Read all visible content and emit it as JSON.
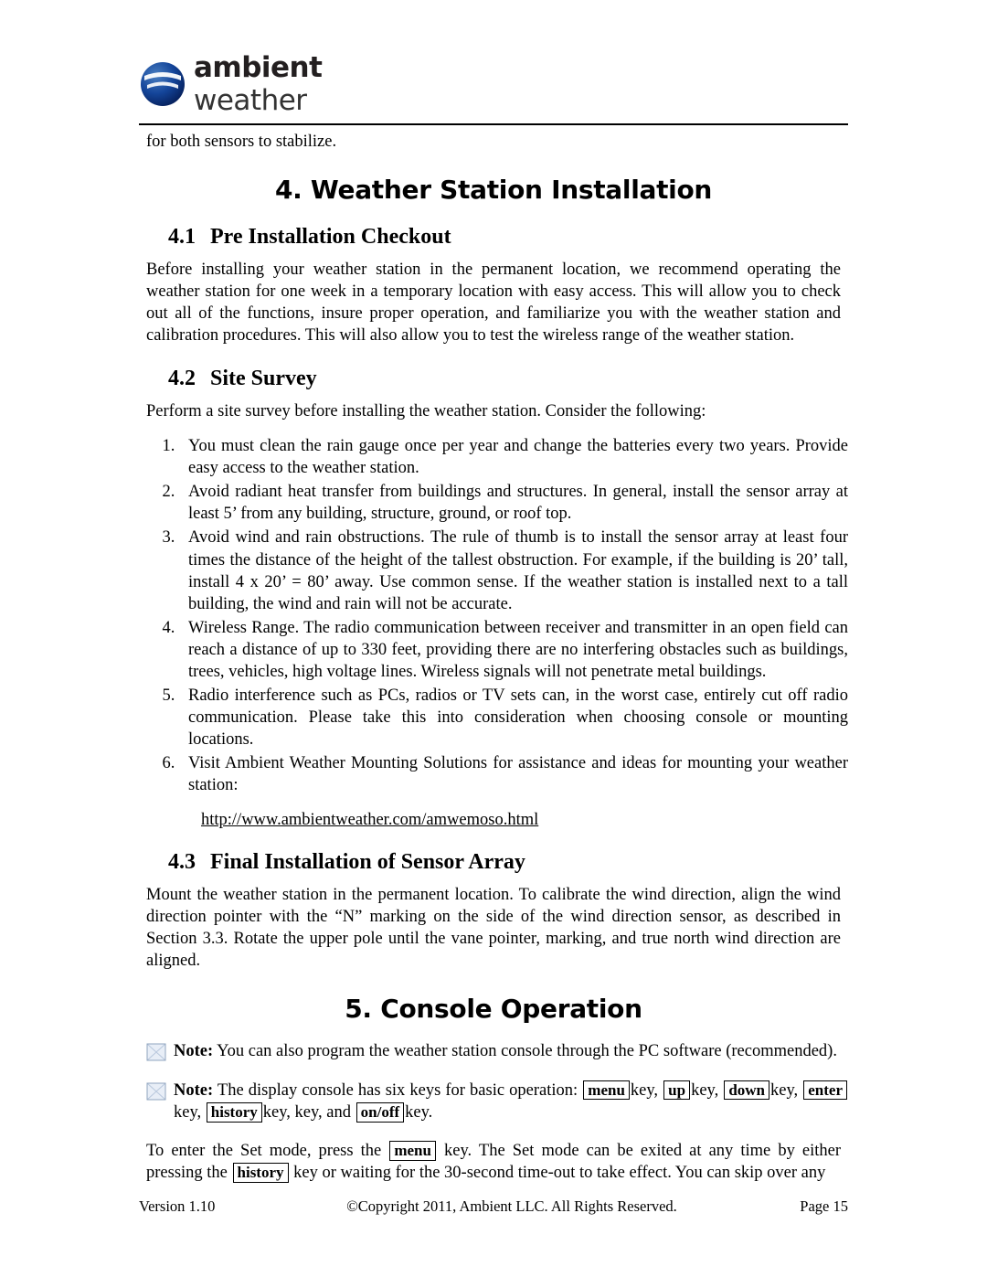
{
  "header": {
    "logo_bold": "ambient",
    "logo_light": "weather"
  },
  "top_fragment": "for both sensors to stabilize.",
  "chapter4": {
    "title": "4. Weather Station Installation",
    "sections": [
      {
        "num": "4.1",
        "title": "Pre Installation Checkout",
        "body": "Before installing your weather station in the permanent location, we recommend operating the weather station for one week in a temporary location with easy access. This will allow you to check out all of the functions, insure proper operation, and familiarize you with the weather station and calibration procedures. This will also allow you to test the wireless range of the weather station."
      },
      {
        "num": "4.2",
        "title": "Site Survey",
        "body": "Perform a site survey before installing the weather station. Consider the following:"
      },
      {
        "num": "4.3",
        "title": "Final Installation of Sensor Array",
        "body": "Mount the weather station in the permanent location. To calibrate the wind direction, align the wind direction pointer with the “N” marking on the side of the wind direction sensor, as described in Section 3.3. Rotate the upper pole until the vane pointer, marking, and true north wind direction are aligned."
      }
    ],
    "survey_items": [
      "You must clean the rain gauge once per year and change the batteries every two years. Provide easy access to the weather station.",
      "Avoid radiant heat transfer from buildings and structures. In general, install the sensor array at least 5’ from any building, structure, ground, or roof top.",
      "Avoid wind and rain obstructions. The rule of thumb is to install the sensor array at least four times the distance of the height of the tallest obstruction. For example, if the building is 20’ tall, install 4 x 20’ = 80’ away. Use common sense. If the weather station is installed next to a tall building, the wind and rain will not be accurate.",
      "Wireless Range. The radio communication between receiver and transmitter in an open field can reach a distance of up to 330 feet, providing there are no interfering obstacles such as buildings, trees, vehicles, high voltage lines.  Wireless signals will not penetrate metal buildings.",
      "Radio interference such as PCs, radios or TV sets can, in the worst case, entirely cut off radio communication. Please take this into consideration when choosing console or mounting locations.",
      "Visit Ambient Weather Mounting Solutions for assistance and ideas for mounting your weather station:"
    ],
    "mounting_url": "http://www.ambientweather.com/amwemoso.html"
  },
  "chapter5": {
    "title": "5. Console Operation",
    "note1_label": "Note:",
    "note1_text": " You can also program the weather station console through the PC software (recommended).",
    "note2_label": "Note:",
    "note2_text_a": " The display console has six keys for basic operation: ",
    "note2_keys": [
      "menu",
      "up",
      "down",
      "enter",
      "history",
      "on/off"
    ],
    "note2_word_key": "key,",
    "note2_word_key_last": "key.",
    "note2_text_b": " key, ",
    "note2_text_and": " key, and ",
    "paragraph_a": "To enter the Set mode, press the ",
    "paragraph_b": " key.   The Set mode can be exited at any time by either pressing the ",
    "paragraph_c": " key or waiting for the 30-second time-out to take effect.   You can skip over any"
  },
  "footer": {
    "version": "Version 1.10",
    "copyright": "©Copyright 2011, Ambient LLC. All Rights Reserved.",
    "page": "Page 15"
  }
}
